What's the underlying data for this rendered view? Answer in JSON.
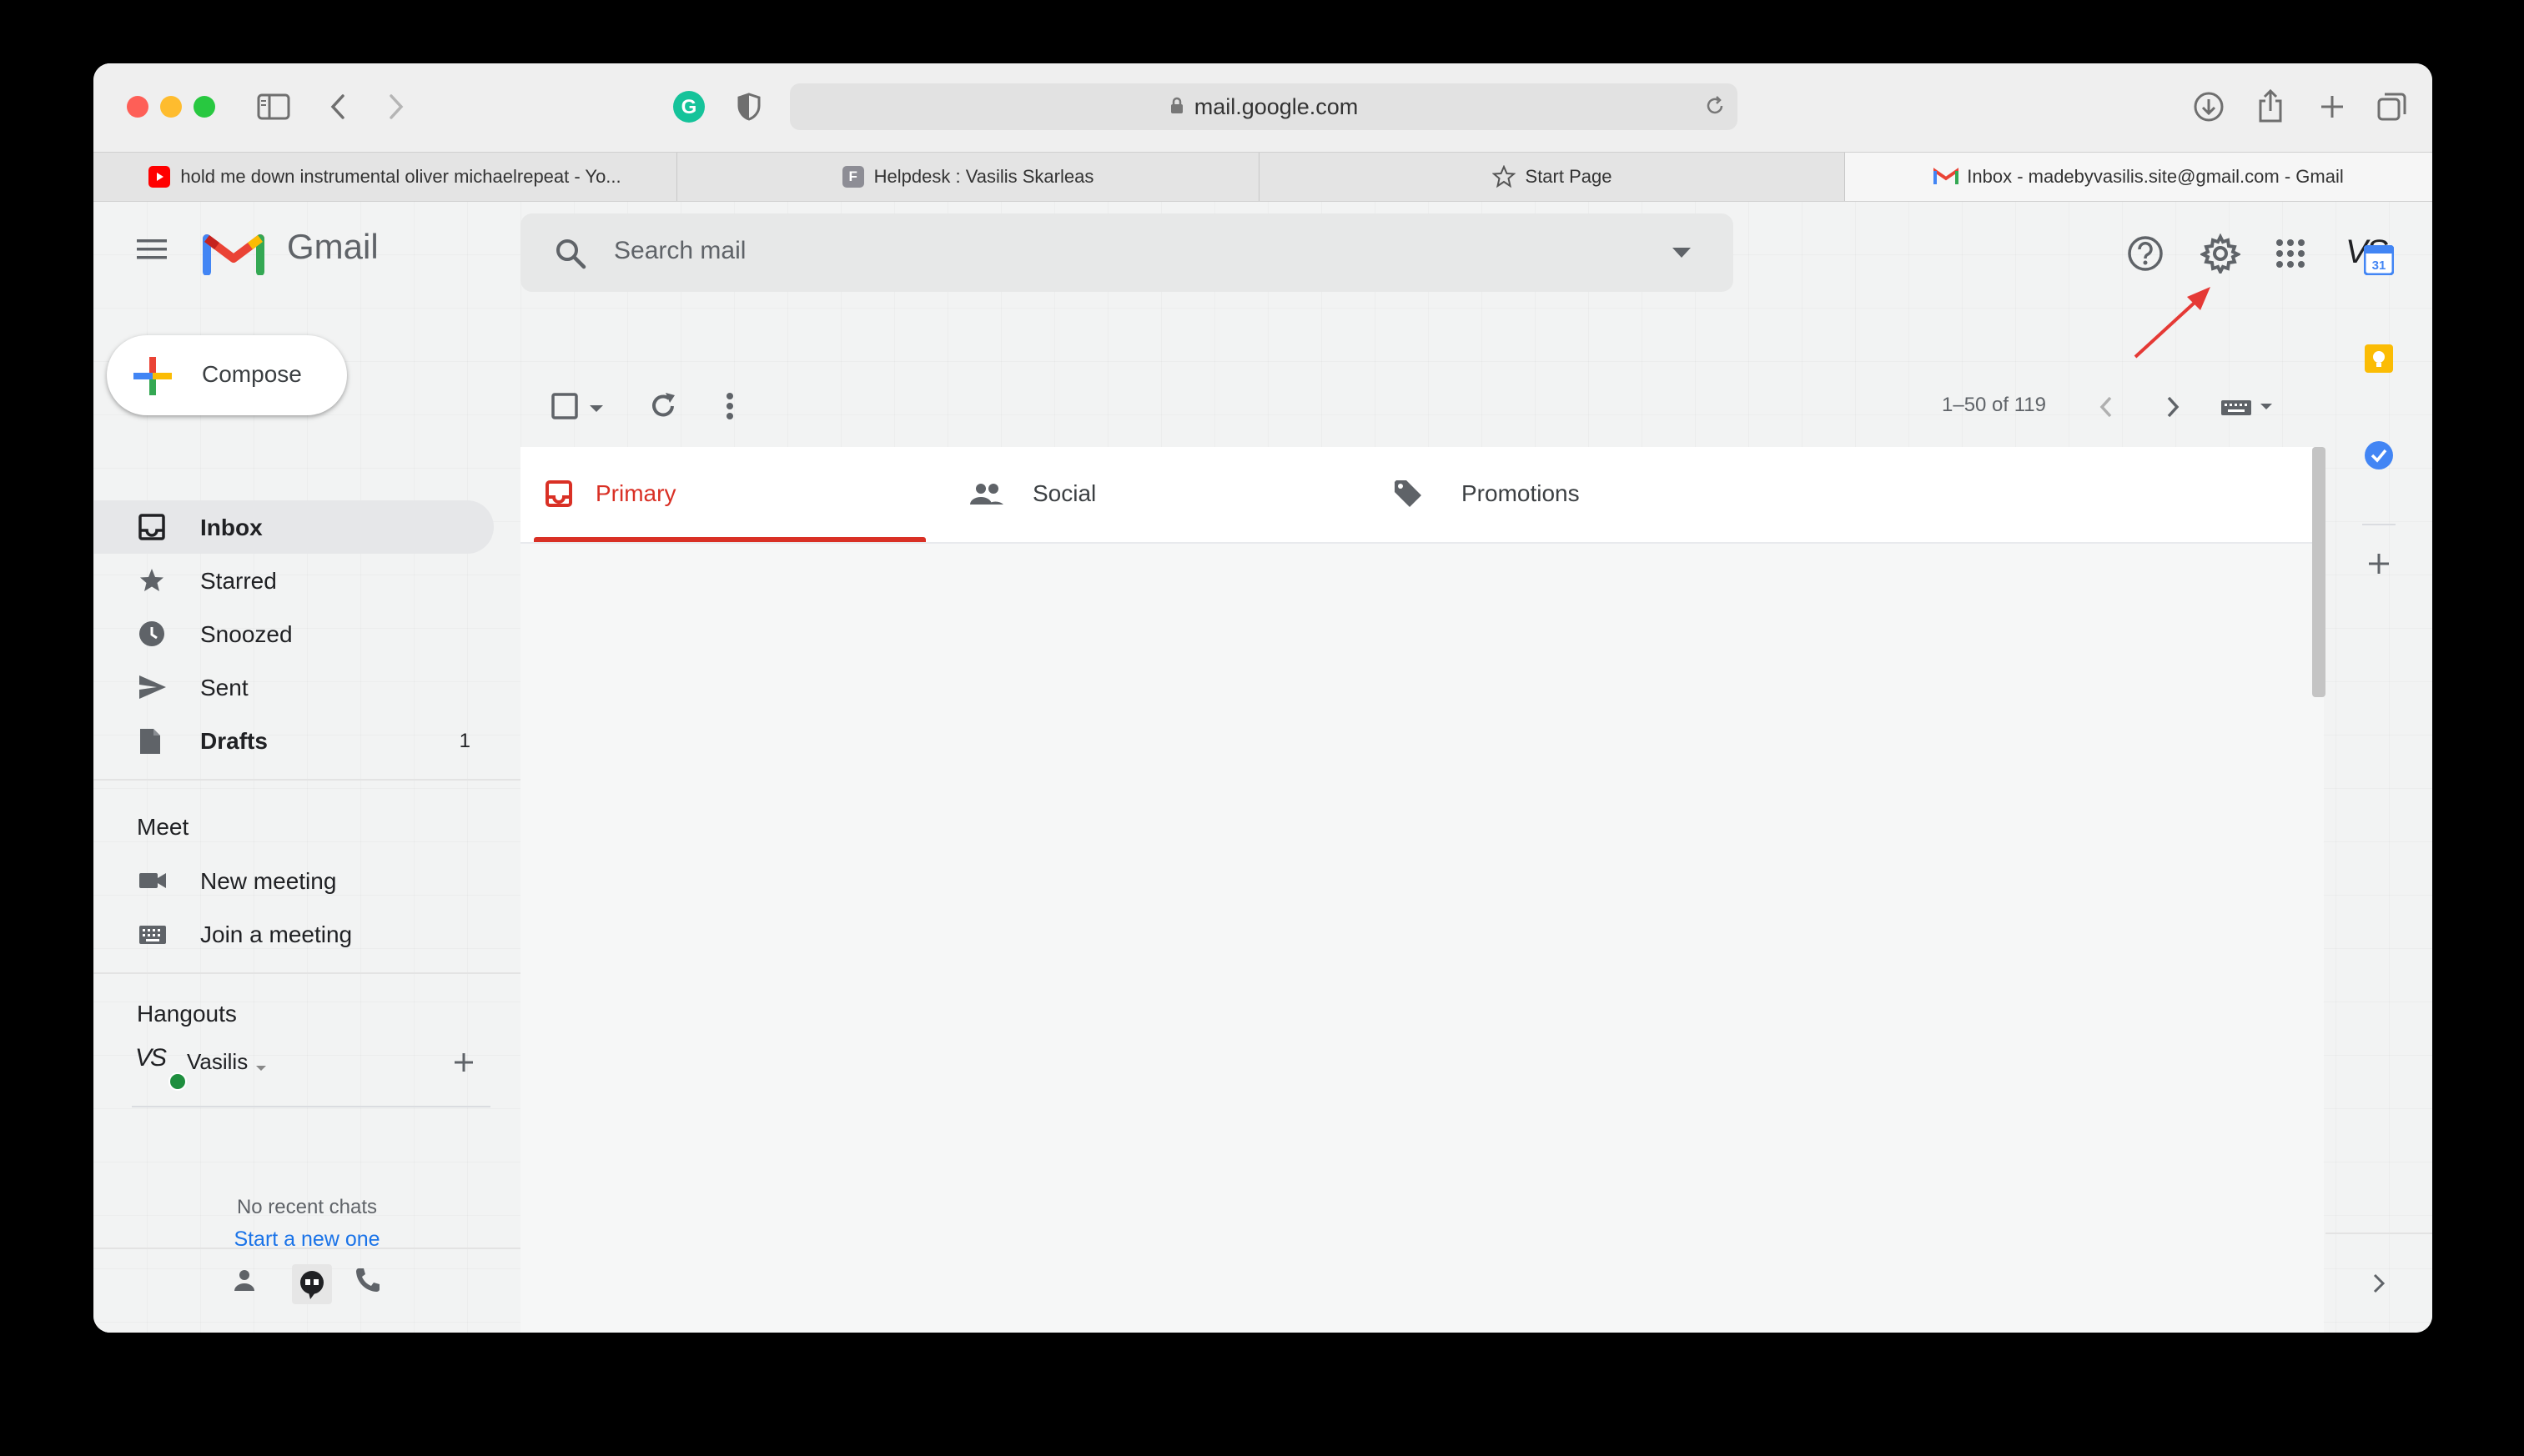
{
  "browser": {
    "url": "mail.google.com",
    "tabs": [
      {
        "title": "hold me down instrumental oliver michaelrepeat - Yo...",
        "favicon": "youtube-icon"
      },
      {
        "title": "Helpdesk : Vasilis Skarleas",
        "favicon": "freshdesk-icon"
      },
      {
        "title": "Start Page",
        "favicon": "star-icon"
      },
      {
        "title": "Inbox - madebyvasilis.site@gmail.com - Gmail",
        "favicon": "gmail-icon"
      }
    ]
  },
  "gmail": {
    "logo_text": "Gmail",
    "search_placeholder": "Search mail",
    "compose_label": "Compose",
    "pagination": "1–50 of 119",
    "avatar_initials": "VS",
    "nav": [
      {
        "label": "Inbox",
        "count": "",
        "icon": "inbox-icon"
      },
      {
        "label": "Starred",
        "count": "",
        "icon": "star-icon"
      },
      {
        "label": "Snoozed",
        "count": "",
        "icon": "clock-icon"
      },
      {
        "label": "Sent",
        "count": "",
        "icon": "send-icon"
      },
      {
        "label": "Drafts",
        "count": "1",
        "icon": "draft-icon"
      }
    ],
    "meet": {
      "title": "Meet",
      "items": [
        {
          "label": "New meeting",
          "icon": "video-camera-icon"
        },
        {
          "label": "Join a meeting",
          "icon": "keyboard-icon"
        }
      ]
    },
    "hangouts": {
      "title": "Hangouts",
      "user": "Vasilis",
      "no_chats": "No recent chats",
      "start_link": "Start a new one"
    },
    "categories": [
      {
        "label": "Primary",
        "icon": "inbox-icon",
        "active": true
      },
      {
        "label": "Social",
        "icon": "people-icon",
        "active": false
      },
      {
        "label": "Promotions",
        "icon": "tag-icon",
        "active": false
      }
    ],
    "colors": {
      "primary_red": "#d93025",
      "link_blue": "#1a73e8",
      "annotation_arrow": "#e53935"
    }
  }
}
